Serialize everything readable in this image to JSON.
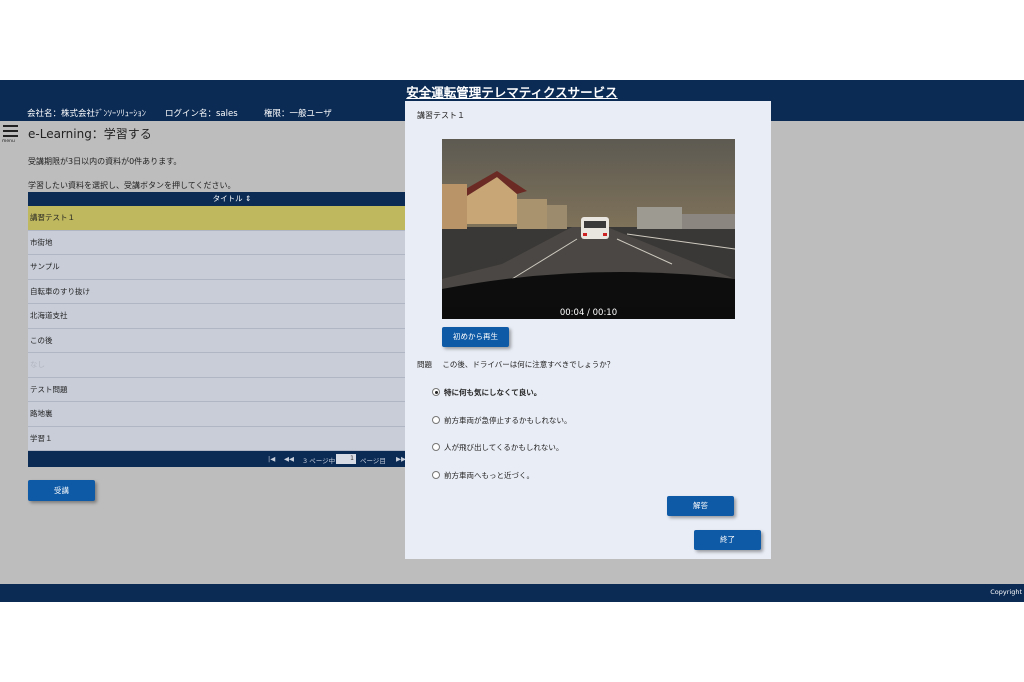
{
  "app_title": "安全運転管理テレマティクスサービス",
  "header": {
    "company": "会社名：株式会社ﾃﾞﾝｿｰｿﾘｭｰｼｮﾝ",
    "login": "ログイン名：sales",
    "role": "権限：一般ユーザ"
  },
  "menu": {
    "label": "menu",
    "icon": "hamburger-icon"
  },
  "page_title": "e-Learning：学習する",
  "notes": {
    "deadline": "受講期限が3日以内の資料が0件あります。",
    "instruction": "学習したい資料を選択し、受講ボタンを押してください。"
  },
  "table": {
    "header": "タイトル ⇕",
    "rows": [
      {
        "title": "講習テスト１",
        "selected": true
      },
      {
        "title": "市街地"
      },
      {
        "title": "サンプル"
      },
      {
        "title": "自転車のすり抜け"
      },
      {
        "title": "北海道支社"
      },
      {
        "title": "この後"
      },
      {
        "title": "なし"
      },
      {
        "title": "テスト問題"
      },
      {
        "title": "路地裏"
      },
      {
        "title": "学習１"
      }
    ],
    "pager": {
      "first": "|◀",
      "prev": "◀◀",
      "pages_of": "3 ページ中",
      "current": "1",
      "page_suffix": "ページ目",
      "next": "▶▶"
    }
  },
  "buttons": {
    "attend": "受講"
  },
  "footer": {
    "copyright": "Copyright"
  },
  "modal": {
    "title": "講習テスト１",
    "video_time": "00:04 / 00:10",
    "replay_button": "初めから再生",
    "question_label": "問題",
    "question": "この後、ドライバーは何に注意すべきでしょうか？",
    "options": [
      {
        "text": "特に何も気にしなくて良い。",
        "selected": true
      },
      {
        "text": "前方車両が急停止するかもしれない。",
        "selected": false
      },
      {
        "text": "人が飛び出してくるかもしれない。",
        "selected": false
      },
      {
        "text": "前方車両へもっと近づく。",
        "selected": false
      }
    ],
    "answer_button": "解答",
    "close_button": "終了"
  },
  "colors": {
    "navy": "#0b2b55",
    "accent_button": "#0f5aa6",
    "selected_row": "#bfb85e",
    "modal_bg": "#e9edf5"
  }
}
